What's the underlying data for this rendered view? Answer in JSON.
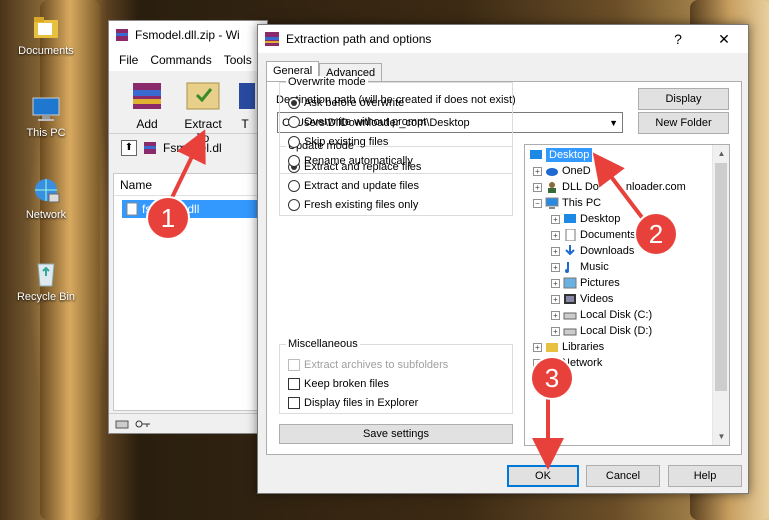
{
  "desktop": {
    "icons": [
      {
        "label": "Documents",
        "icon": "folder-documents-icon"
      },
      {
        "label": "This PC",
        "icon": "computer-icon"
      },
      {
        "label": "Network",
        "icon": "network-icon"
      },
      {
        "label": "Recycle Bin",
        "icon": "recycle-bin-icon"
      }
    ]
  },
  "winrar": {
    "title": "Fsmodel.dll.zip - Wi",
    "menu": [
      "File",
      "Commands",
      "Tools"
    ],
    "toolbar": {
      "add": "Add",
      "extract_to": "Extract To",
      "test": "T"
    },
    "address": "Fsmodel.dl",
    "list_header": "Name",
    "selected_file": "fsmodel.dll"
  },
  "dialog": {
    "title": "Extraction path and options",
    "help": "?",
    "close": "✕",
    "tabs": {
      "general": "General",
      "advanced": "Advanced"
    },
    "dest_label": "Destination path (will be created if does not exist)",
    "dest_value": "C:\\Users\\DllDownloader_com\\Desktop",
    "display_btn": "Display",
    "new_folder_btn": "New Folder",
    "update_mode": {
      "title": "Update mode",
      "options": [
        "Extract and replace files",
        "Extract and update files",
        "Fresh existing files only"
      ]
    },
    "overwrite_mode": {
      "title": "Overwrite mode",
      "options": [
        "Ask before overwrite",
        "Overwrite without prompt",
        "Skip existing files",
        "Rename automatically"
      ]
    },
    "misc": {
      "title": "Miscellaneous",
      "options": [
        "Extract archives to subfolders",
        "Keep broken files",
        "Display files in Explorer"
      ]
    },
    "save_settings": "Save settings",
    "tree": [
      "Desktop",
      "OneD",
      "DLL Do",
      "nloader.com",
      "This PC",
      "Desktop",
      "Documents",
      "Downloads",
      "Music",
      "Pictures",
      "Videos",
      "Local Disk (C:)",
      "Local Disk (D:)",
      "Libraries",
      "Network"
    ],
    "ok": "OK",
    "cancel": "Cancel",
    "help_btn": "Help"
  },
  "callouts": [
    "1",
    "2",
    "3"
  ],
  "colors": {
    "selection": "#3399ff",
    "callout": "#e8413b",
    "ok_border": "#0078d7"
  }
}
